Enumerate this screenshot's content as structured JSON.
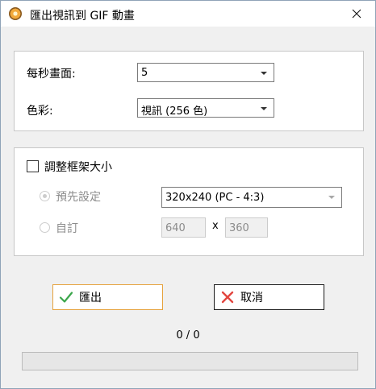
{
  "window": {
    "title": "匯出視訊到 GIF 動畫"
  },
  "frames_per_second": {
    "label": "每秒畫面:",
    "value": "5"
  },
  "color": {
    "label": "色彩:",
    "value": "視訊 (256 色)"
  },
  "resize": {
    "checkbox_label": "調整框架大小",
    "checked": false,
    "preset": {
      "label": "預先設定",
      "selected": true,
      "value": "320x240 (PC - 4:3)"
    },
    "custom": {
      "label": "自訂",
      "selected": false,
      "width": "640",
      "separator": "x",
      "height": "360"
    }
  },
  "buttons": {
    "export": "匯出",
    "cancel": "取消"
  },
  "progress": {
    "text": "0 / 0",
    "fraction": 0
  },
  "icons": {
    "app": "app-icon",
    "close": "close-icon",
    "export": "checkmark-icon",
    "cancel": "x-icon",
    "dropdown": "chevron-down-icon"
  },
  "colors": {
    "export_border": "#e6a23c",
    "check_green": "#3aa64a",
    "cancel_red": "#e2463f"
  }
}
